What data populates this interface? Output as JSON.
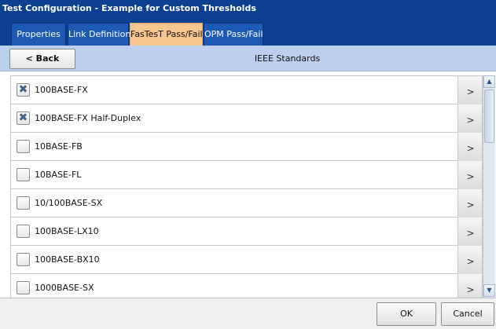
{
  "window": {
    "title": "Test Configuration - Example for Custom Thresholds"
  },
  "tabs": [
    {
      "label": "Properties",
      "active": false
    },
    {
      "label": "Link Definition",
      "active": false
    },
    {
      "label": "FasTesT Pass/Fail",
      "active": true
    },
    {
      "label": "OPM Pass/Fail",
      "active": false
    }
  ],
  "nav": {
    "back_label": "< Back",
    "title": "IEEE Standards"
  },
  "list": {
    "items": [
      {
        "label": "100BASE-FX",
        "checked": true
      },
      {
        "label": "100BASE-FX Half-Duplex",
        "checked": true
      },
      {
        "label": "10BASE-FB",
        "checked": false
      },
      {
        "label": "10BASE-FL",
        "checked": false
      },
      {
        "label": "10/100BASE-SX",
        "checked": false
      },
      {
        "label": "100BASE-LX10",
        "checked": false
      },
      {
        "label": "100BASE-BX10",
        "checked": false
      },
      {
        "label": "1000BASE-SX",
        "checked": false
      }
    ],
    "row_arrow": ">",
    "check_mark": "✖"
  },
  "scrollbar": {
    "up_arrow": "▲",
    "down_arrow": "▼"
  },
  "footer": {
    "ok_label": "OK",
    "cancel_label": "Cancel"
  },
  "colors": {
    "title_bar": "#0b3f8f",
    "tab_inactive": "#1d5ab5",
    "tab_active": "#f7c58e",
    "nav_bar": "#bcd0ee"
  }
}
